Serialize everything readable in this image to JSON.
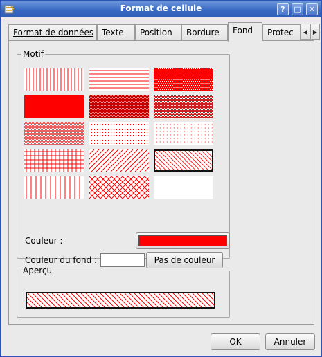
{
  "window": {
    "title": "Format de cellule",
    "buttons": {
      "help": "?",
      "maximize": "□",
      "close": "✕"
    }
  },
  "tabs": [
    {
      "label": "Format de données",
      "active": false
    },
    {
      "label": "Texte",
      "active": false
    },
    {
      "label": "Position",
      "active": false
    },
    {
      "label": "Bordure",
      "active": false
    },
    {
      "label": "Fond",
      "active": true
    },
    {
      "label": "Protec",
      "active": false
    }
  ],
  "tab_scroll": {
    "left": "◀",
    "right": "▶"
  },
  "motif": {
    "title": "Motif",
    "patterns": [
      "vertical-lines",
      "horizontal-lines",
      "dense-dots",
      "solid",
      "dense-dots-2",
      "medium-dots",
      "sparse-dots",
      "fine-dots",
      "very-fine-dots",
      "grid",
      "diagonal-forward",
      "diagonal-back",
      "vertical-lines-wide",
      "diagonal-cross",
      "none"
    ],
    "selected_pattern": "diagonal-back",
    "pattern_color": "#ff0000",
    "couleur_label": "Couleur :",
    "couleur_fond_label": "Couleur du fond :",
    "pas_de_couleur_label": "Pas de couleur"
  },
  "apercu": {
    "title": "Aperçu"
  },
  "footer": {
    "ok_label": "OK",
    "cancel_label": "Annuler"
  }
}
